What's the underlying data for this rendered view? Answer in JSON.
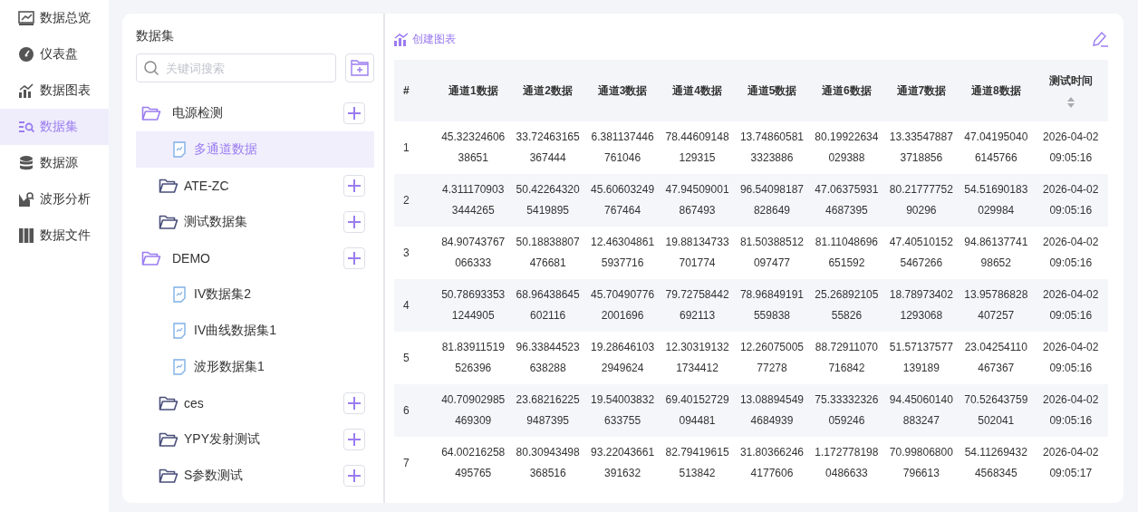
{
  "nav": [
    {
      "label": "数据总览",
      "kind": "overview",
      "selected": false
    },
    {
      "label": "仪表盘",
      "kind": "gauge",
      "selected": false
    },
    {
      "label": "数据图表",
      "kind": "chart",
      "selected": false
    },
    {
      "label": "数据集",
      "kind": "dataset",
      "selected": true
    },
    {
      "label": "数据源",
      "kind": "database",
      "selected": false
    },
    {
      "label": "波形分析",
      "kind": "wave",
      "selected": false
    },
    {
      "label": "数据文件",
      "kind": "files",
      "selected": false
    }
  ],
  "tree_panel": {
    "title": "数据集",
    "search": {
      "placeholder": "关键词搜索"
    },
    "folders": [
      {
        "label": "电源检测",
        "expanded": true,
        "children": [
          {
            "label": "多通道数据",
            "selected": true
          }
        ]
      },
      {
        "label": "ATE-ZC",
        "expanded": false
      },
      {
        "label": "测试数据集",
        "expanded": false
      },
      {
        "label": "DEMO",
        "expanded": true,
        "children": [
          {
            "label": "IV数据集2",
            "selected": false
          },
          {
            "label": "IV曲线数据集1",
            "selected": false
          },
          {
            "label": "波形数据集1",
            "selected": false
          }
        ]
      },
      {
        "label": "ces",
        "expanded": false
      },
      {
        "label": "YPY发射测试",
        "expanded": false
      },
      {
        "label": "S参数测试",
        "expanded": false
      }
    ]
  },
  "toolbar": {
    "create_chart": "创建图表"
  },
  "table": {
    "columns": [
      "#",
      "通道1数据",
      "通道2数据",
      "通道3数据",
      "通道4数据",
      "通道5数据",
      "通道6数据",
      "通道7数据",
      "通道8数据",
      "测试时间"
    ],
    "rows": [
      [
        "1",
        "45.3232460638651",
        "33.72463165367444",
        "6.381137446761046",
        "78.44609148129315",
        "13.748605813323886",
        "80.19922634029388",
        "13.335478873718856",
        "47.041950406145766",
        "2026-04-02 09:05:16"
      ],
      [
        "2",
        "4.3111709033444265",
        "50.422643205419895",
        "45.60603249767464",
        "47.94509001867493",
        "96.54098187828649",
        "47.063759314687395",
        "80.2177775290296",
        "54.51690183029984",
        "2026-04-02 09:05:16"
      ],
      [
        "3",
        "84.90743767066333",
        "50.18838807476681",
        "12.463048615937716",
        "19.88134733701774",
        "81.50388512097477",
        "81.11048696651592",
        "47.405101525467266",
        "94.8613774198652",
        "2026-04-02 09:05:16"
      ],
      [
        "4",
        "50.786933531244905",
        "68.96438645602116",
        "45.704907762001696",
        "79.72758442692113",
        "78.96849191559838",
        "25.2689210555826",
        "18.789734021293068",
        "13.95786828407257",
        "2026-04-02 09:05:16"
      ],
      [
        "5",
        "81.83911519526396",
        "96.33844523638288",
        "19.286461032949624",
        "12.303191321734412",
        "12.2607500577278",
        "88.72911070716842",
        "51.57137577139189",
        "23.04254110467367",
        "2026-04-02 09:05:16"
      ],
      [
        "6",
        "40.70902985469309",
        "23.682162259487395",
        "19.54003832633755",
        "69.40152729094481",
        "13.088945494684939",
        "75.33332326059246",
        "94.45060140883247",
        "70.52643759502041",
        "2026-04-02 09:05:16"
      ],
      [
        "7",
        "64.00216258495765",
        "80.30943498368516",
        "93.22043661391632",
        "82.79419615513842",
        "31.803662464177606",
        "1.1727781980486633",
        "70.99806800796613",
        "54.112694324568345",
        "2026-04-02 09:05:17"
      ]
    ]
  }
}
